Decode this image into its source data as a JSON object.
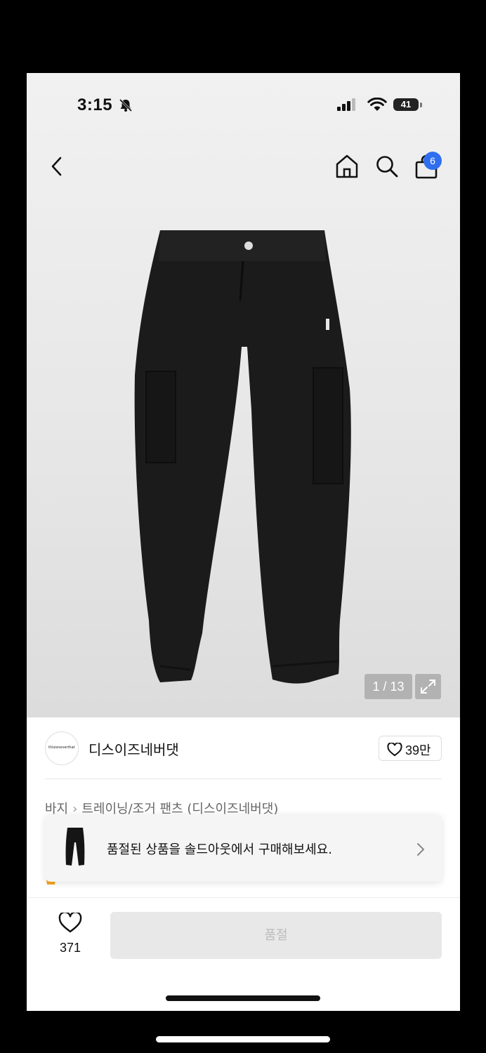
{
  "status_bar": {
    "time": "3:15",
    "battery": "41"
  },
  "header": {
    "cart_count": "6"
  },
  "gallery": {
    "counter": "1 / 13"
  },
  "brand": {
    "logo_text": "thisisneverthat",
    "name": "디스이즈네버댓",
    "likes": "39만"
  },
  "breadcrumb": {
    "category": "바지",
    "subcategory": "트레이닝/조거 팬츠 (디스이즈네버댓)"
  },
  "toast": {
    "message": "품절된 상품을 솔드아웃에서 구매해보세요."
  },
  "bottom_bar": {
    "wish_count": "371",
    "buy_label": "품절"
  },
  "colors": {
    "badge": "#2f6fef",
    "button_disabled": "#e8e8e8"
  }
}
